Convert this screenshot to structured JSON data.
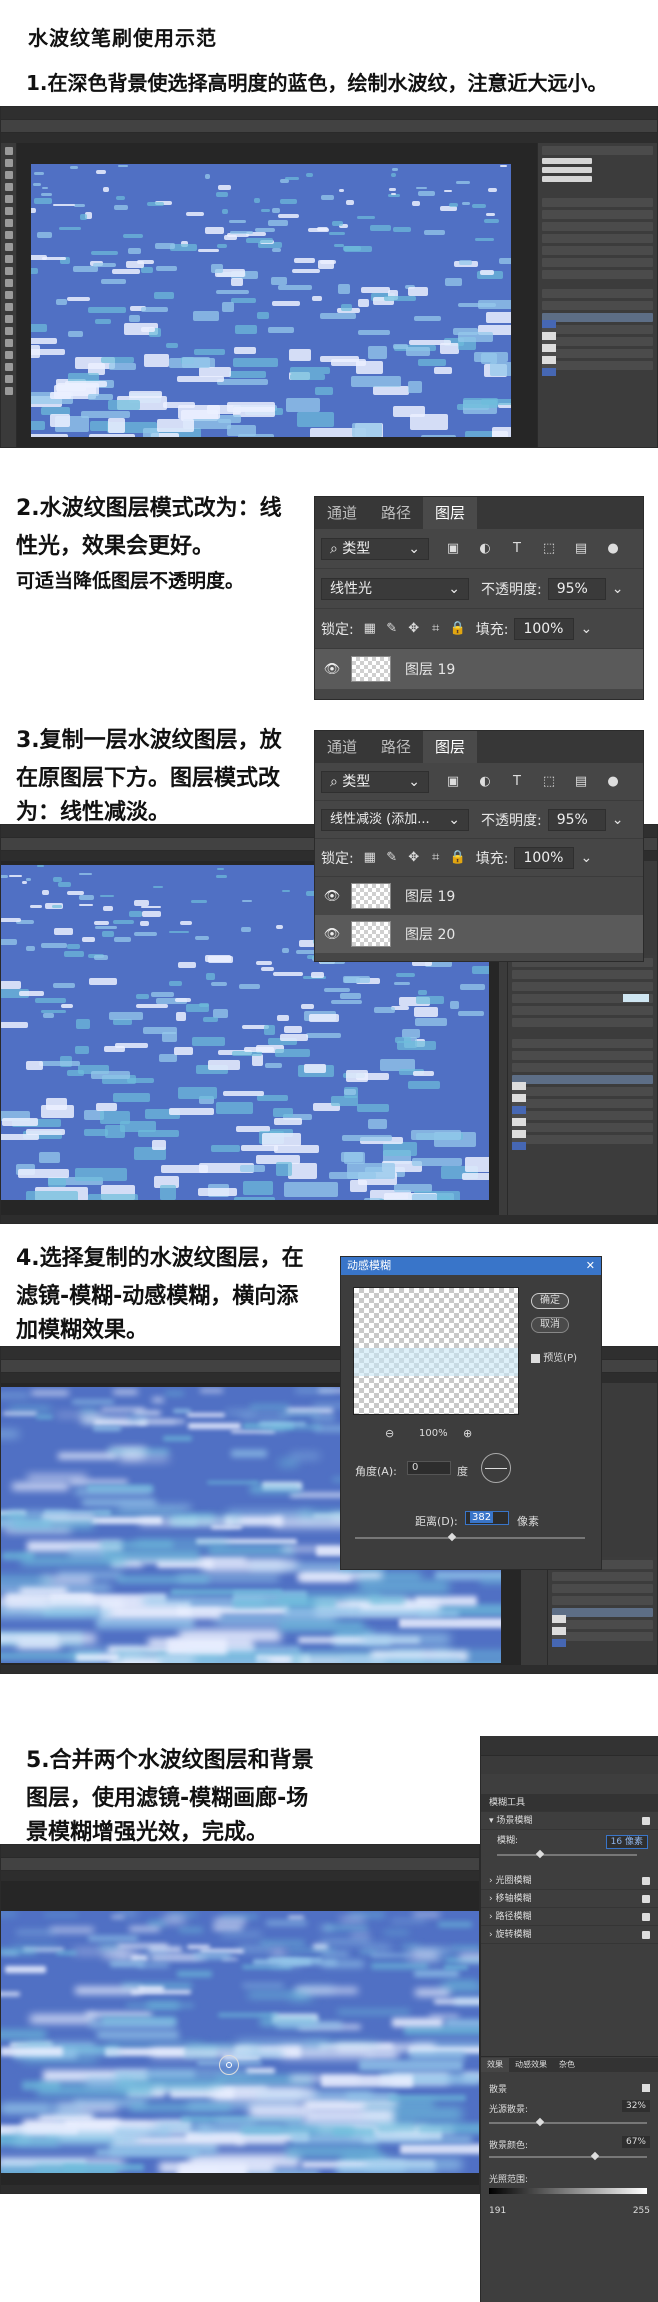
{
  "title": "水波纹笔刷使用示范",
  "steps": [
    {
      "text": "1.在深色背景使选择高明度的蓝色，绘制水波纹，注意近大远小。"
    },
    {
      "lines": [
        "2.水波纹图层模式改为：线",
        "性光，效果会更好。",
        "可适当降低图层不透明度。"
      ]
    },
    {
      "lines": [
        "3.复制一层水波纹图层，放",
        "在原图层下方。图层模式改",
        "为：线性减淡。"
      ]
    },
    {
      "lines": [
        "4.选择复制的水波纹图层，在",
        "滤镜-模糊-动感模糊，横向添",
        "加模糊效果。"
      ]
    },
    {
      "lines": [
        "5.合并两个水波纹图层和背景",
        "图层，使用滤镜-模糊画廊-场",
        "景模糊增强光效，完成。"
      ]
    }
  ],
  "colors": {
    "water": "#5070c4",
    "accent": "#3975c9",
    "panel": "#464646"
  },
  "layers_panel_1": {
    "tabs": [
      "通道",
      "路径",
      "图层"
    ],
    "active_tab": "图层",
    "filter": "类型",
    "blend_mode": "线性光",
    "opacity_label": "不透明度:",
    "opacity": "95%",
    "lock_label": "锁定:",
    "fill_label": "填充:",
    "fill": "100%",
    "layers": [
      {
        "name": "图层 19",
        "selected": true
      }
    ]
  },
  "layers_panel_2": {
    "tabs": [
      "通道",
      "路径",
      "图层"
    ],
    "active_tab": "图层",
    "filter": "类型",
    "blend_mode": "线性减淡 (添加...",
    "opacity_label": "不透明度:",
    "opacity": "95%",
    "lock_label": "锁定:",
    "fill_label": "填充:",
    "fill": "100%",
    "layers": [
      {
        "name": "图层 19",
        "selected": false
      },
      {
        "name": "图层 20",
        "selected": true
      }
    ]
  },
  "motion_blur": {
    "title": "动感模糊",
    "ok": "确定",
    "cancel": "取消",
    "preview": "预览(P)",
    "zoom": "100%",
    "angle_label": "角度(A):",
    "angle": "0",
    "angle_unit": "度",
    "distance_label": "距离(D):",
    "distance": "382",
    "distance_unit": "像素"
  },
  "blur_gallery": {
    "title": "模糊工具",
    "items": [
      "场景模糊",
      "光圈模糊",
      "移轴模糊",
      "路径模糊",
      "旋转模糊"
    ],
    "blur_label": "模糊:",
    "blur_value": "16 像素",
    "effects_tabs": [
      "效果",
      "动感效果",
      "杂色"
    ],
    "bokeh_label": "散景",
    "light_bokeh_label": "光源散景:",
    "light_bokeh": "32%",
    "bokeh_color_label": "散景颜色:",
    "bokeh_color": "67%",
    "light_range_label": "光照范围:",
    "light_range_min": "191",
    "light_range_max": "255"
  }
}
